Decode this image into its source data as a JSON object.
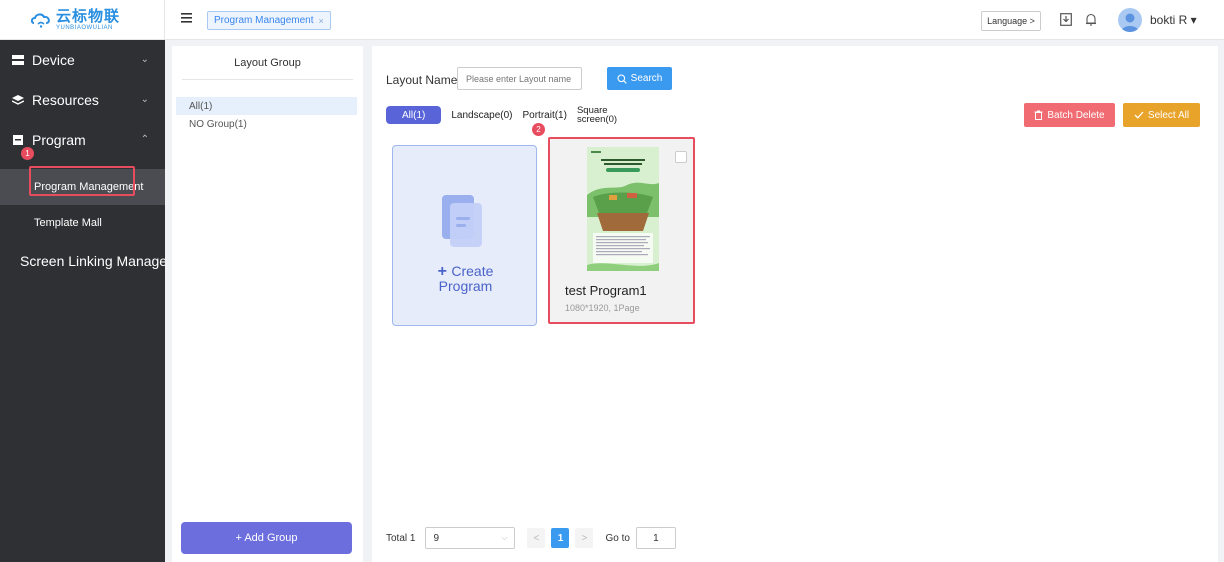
{
  "brand": {
    "name_cn": "云标物联",
    "name_en": "YUNBIAOWULIAN",
    "color": "#2b8fe0"
  },
  "sidebar": {
    "items": [
      {
        "label": "Device",
        "icon": "server-icon",
        "chevron": "⌄"
      },
      {
        "label": "Resources",
        "icon": "layers-icon",
        "chevron": "⌄"
      },
      {
        "label": "Program",
        "icon": "program-icon",
        "chevron": "⌃",
        "badge": "1",
        "children": [
          {
            "label": "Program Management",
            "active": true
          },
          {
            "label": "Template Mall"
          }
        ]
      },
      {
        "label": "Screen Linking Management",
        "icon": "screens-icon"
      }
    ]
  },
  "header": {
    "open_tab": "Program Management",
    "tab_close": "×",
    "language_label": "Language >",
    "username": "bokti R ▾"
  },
  "groups": {
    "title": "Layout Group",
    "items": [
      {
        "label": "All(1)",
        "active": true
      },
      {
        "label": "NO Group(1)"
      }
    ],
    "add_label": "+ Add Group"
  },
  "main": {
    "search": {
      "label": "Layout Name",
      "placeholder": "Please enter Layout name",
      "button": "Search"
    },
    "filters": [
      {
        "label": "All(1)",
        "active": true
      },
      {
        "label": "Landscape(0)"
      },
      {
        "label": "Portrait(1)",
        "badge": "2"
      },
      {
        "label_line1": "Square",
        "label_line2": "screen(0)"
      }
    ],
    "batch_delete": "Batch Delete",
    "select_all": "Select All",
    "create_card": {
      "line1": "Create",
      "line2": "Program"
    },
    "programs": [
      {
        "name": "test Program1",
        "meta": "1080*1920,  1Page"
      }
    ],
    "pagination": {
      "total": "Total 1",
      "page_size": "9",
      "prev": "<",
      "current": "1",
      "next": ">",
      "goto_label": "Go to",
      "goto_value": "1"
    }
  },
  "colors": {
    "sidebar_bg": "#2f3033",
    "accent_blue": "#3a9af0",
    "purple": "#5864d8",
    "danger": "#f06c72",
    "warning": "#e8a32a",
    "highlight": "#e84c5f"
  }
}
